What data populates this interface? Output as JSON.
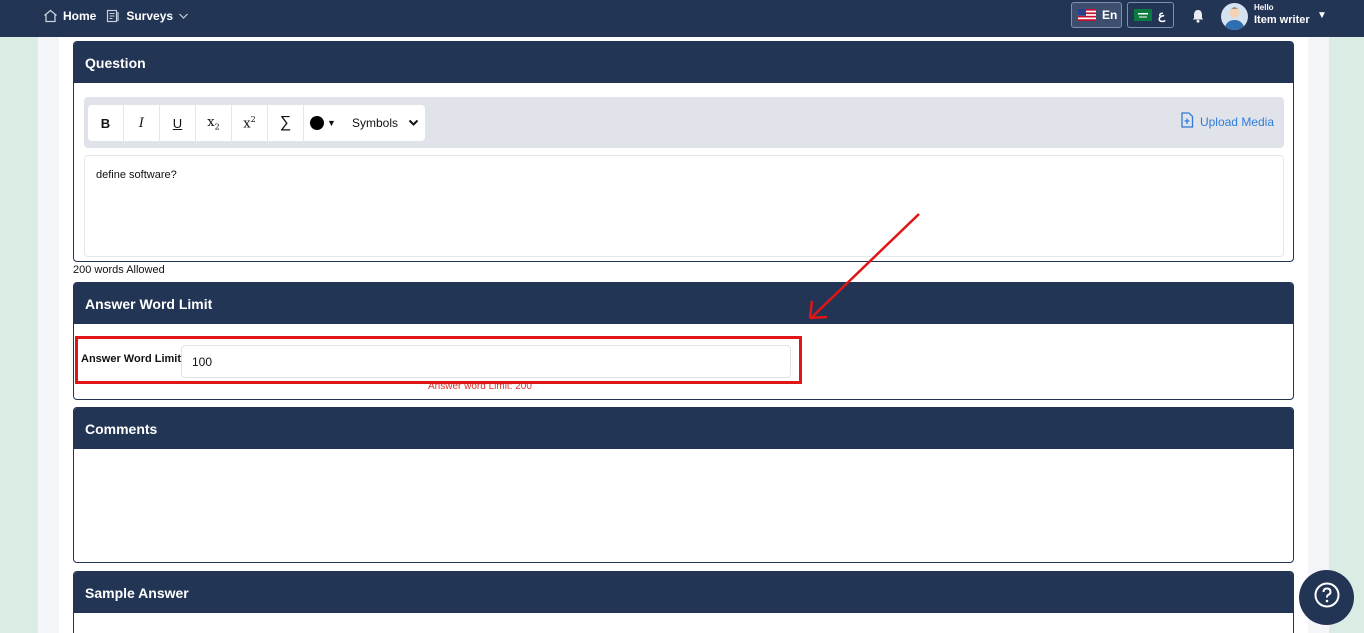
{
  "nav": {
    "home_label": "Home",
    "surveys_label": "Surveys",
    "lang_en_label": "En",
    "lang_ar_label": "ع",
    "user_greeting": "Hello",
    "user_name": "Item writer"
  },
  "question": {
    "title": "Question",
    "toolbar": {
      "bold": "B",
      "italic": "I",
      "underline": "U",
      "symbols_label": "Symbols",
      "current_color": "#000000"
    },
    "upload_label": "Upload Media",
    "text": "define software?",
    "words_allowed": "200 words Allowed"
  },
  "answer_word_limit": {
    "title": "Answer Word Limit",
    "field_label": "Answer Word Limit",
    "value": "100",
    "hint": "Answer word Limit: 200"
  },
  "comments": {
    "title": "Comments"
  },
  "sample_answer": {
    "title": "Sample Answer"
  },
  "colors": {
    "header_navy": "#233554",
    "accent_blue": "#2f7bd9",
    "annotation_red": "#e01515",
    "hint_red": "#e0332e",
    "page_green": "#dbece4"
  }
}
